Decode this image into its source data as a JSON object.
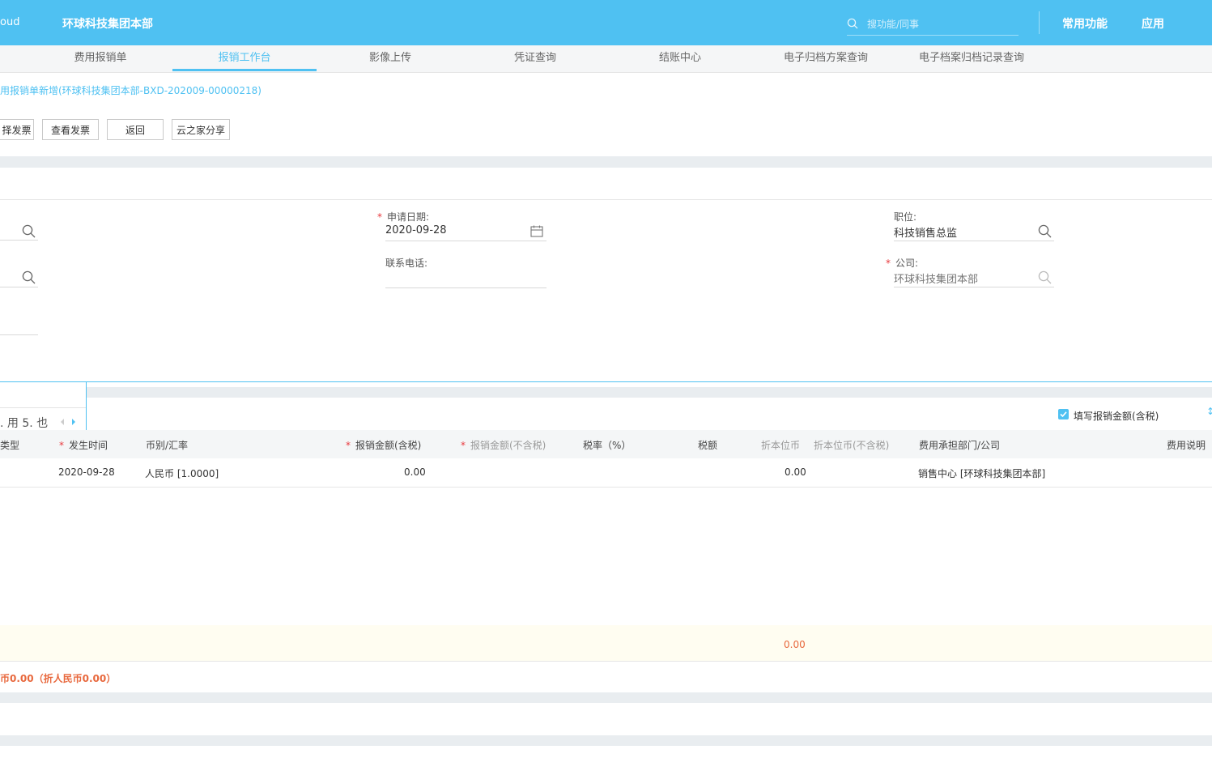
{
  "header": {
    "brand": "oud",
    "org_name": "环球科技集团本部",
    "search_placeholder": "搜功能/同事",
    "nav": [
      "常用功能",
      "应用"
    ]
  },
  "tabs": [
    {
      "label": "费用报销单",
      "active": false
    },
    {
      "label": "报销工作台",
      "active": true
    },
    {
      "label": "影像上传",
      "active": false
    },
    {
      "label": "凭证查询",
      "active": false
    },
    {
      "label": "结账中心",
      "active": false
    },
    {
      "label": "电子归档方案查询",
      "active": false
    },
    {
      "label": "电子档案归档记录查询",
      "active": false
    }
  ],
  "breadcrumb": "用报销单新增(环球科技集团本部-BXD-202009-00000218)",
  "toolbar": {
    "buttons": [
      "择发票",
      "查看发票",
      "返回",
      "云之家分享"
    ]
  },
  "form": {
    "apply_date_label": "申请日期:",
    "apply_date_value": "2020-09-28",
    "phone_label": "联系电话:",
    "phone_value": "",
    "position_label": "职位:",
    "position_value": "科技销售总监",
    "company_label": "公司:",
    "company_value": "环球科技集团本部"
  },
  "popup": {
    "text": ". 用  5. 也"
  },
  "grid": {
    "checkbox_label": "填写报销金额(含税)",
    "checkbox_checked": true,
    "columns": [
      "类型",
      "发生时间",
      "币别/汇率",
      "报销金额(含税)",
      "报销金额(不含税)",
      "税率（%）",
      "税额",
      "折本位币",
      "折本位币(不含税)",
      "费用承担部门/公司",
      "费用说明"
    ],
    "rows": [
      {
        "type": "",
        "date": "2020-09-28",
        "currency": "人民币 [1.0000]",
        "amount_tax": "0.00",
        "amount_notax": "",
        "tax_rate": "",
        "tax": "",
        "base": "0.00",
        "base_notax": "",
        "dept": "销售中心 [环球科技集团本部]",
        "desc": ""
      }
    ],
    "total_base": "0.00"
  },
  "summary": "币0.00（折人民币0.00）",
  "colors": {
    "accent": "#4fc1f2",
    "required": "#e8383d",
    "total": "#e8683d"
  }
}
